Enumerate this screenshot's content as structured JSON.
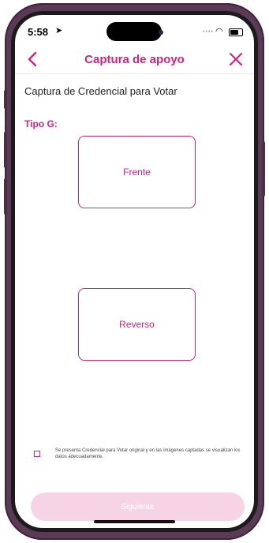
{
  "status_bar": {
    "time": "5:58"
  },
  "nav": {
    "title": "Captura de apoyo"
  },
  "content": {
    "heading": "Captura de Credencial para Votar",
    "type_label": "Tipo G:",
    "front_label": "Frente",
    "back_label": "Reverso",
    "consent_text": "Se presenta Credencial para Votar original y en las imágenes captadas se visualizan los datos adecuadamente."
  },
  "footer": {
    "next_label": "Siguiente"
  },
  "colors": {
    "accent": "#d4217f",
    "disabled_button": "#f6d4e5",
    "frame": "#5a3a55"
  }
}
